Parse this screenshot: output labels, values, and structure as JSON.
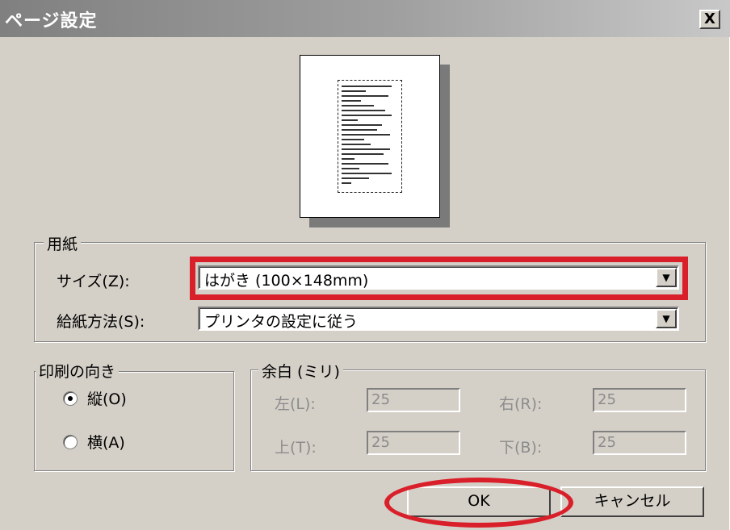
{
  "window": {
    "title": "ページ設定",
    "close_label": "X"
  },
  "paper": {
    "group_label": "用紙",
    "size_label": "サイズ(Z):",
    "size_value": "はがき (100×148mm)",
    "source_label": "給紙方法(S):",
    "source_value": "プリンタの設定に従う"
  },
  "orientation": {
    "group_label": "印刷の向き",
    "portrait_label": "縦(O)",
    "landscape_label": "横(A)",
    "selected": "portrait"
  },
  "margins": {
    "group_label": "余白 (ミリ)",
    "left_label": "左(L):",
    "left_value": "25",
    "right_label": "右(R):",
    "right_value": "25",
    "top_label": "上(T):",
    "top_value": "25",
    "bottom_label": "下(B):",
    "bottom_value": "25"
  },
  "buttons": {
    "ok_label": "OK",
    "cancel_label": "キャンセル"
  },
  "annotations": {
    "highlight_color": "#d9202a"
  }
}
